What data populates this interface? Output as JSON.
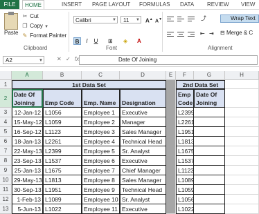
{
  "ribbon": {
    "tabs": [
      {
        "label": "FILE"
      },
      {
        "label": "HOME"
      },
      {
        "label": "INSERT"
      },
      {
        "label": "PAGE LAYOUT"
      },
      {
        "label": "FORMULAS"
      },
      {
        "label": "DATA"
      },
      {
        "label": "REVIEW"
      },
      {
        "label": "VIEW"
      }
    ],
    "clipboard": {
      "paste": "Paste",
      "cut": "Cut",
      "copy": "Copy",
      "format_painter": "Format Painter",
      "group": "Clipboard"
    },
    "font": {
      "name": "Calibri",
      "size": "11",
      "group": "Font"
    },
    "alignment": {
      "wrap": "Wrap Text",
      "merge": "Merge & C",
      "group": "Alignment"
    }
  },
  "formula_bar": {
    "name_box": "A2",
    "fx": "fx",
    "value": "Date Of Joining"
  },
  "columns": [
    "A",
    "B",
    "C",
    "D",
    "E",
    "F",
    "G",
    "H"
  ],
  "rows": [
    "1",
    "2",
    "3",
    "4",
    "5",
    "6",
    "7",
    "8",
    "9",
    "10",
    "11",
    "12",
    "13"
  ],
  "table1": {
    "title": "1st Data Set",
    "headers": [
      "Date Of Joining",
      "Emp Code",
      "Emp. Name",
      "Designation"
    ],
    "rows": [
      [
        "12-Jan-12",
        "L1056",
        "Employee 1",
        "Executive"
      ],
      [
        "15-May-12",
        "L1059",
        "Employee 2",
        "Manager"
      ],
      [
        "16-Sep-12",
        "L1123",
        "Employee 3",
        "Sales Manager"
      ],
      [
        "18-Jan-13",
        "L2261",
        "Employee 4",
        "Technical Head"
      ],
      [
        "22-May-13",
        "L2399",
        "Employee 5",
        "Sr. Analyst"
      ],
      [
        "23-Sep-13",
        "L1537",
        "Employee 6",
        "Executive"
      ],
      [
        "25-Jan-13",
        "L1675",
        "Employee 7",
        "Chief Manager"
      ],
      [
        "29-May-13",
        "L1813",
        "Employee 8",
        "Sales Manager"
      ],
      [
        "30-Sep-13",
        "L1951",
        "Employee 9",
        "Technical Head"
      ],
      [
        "1-Feb-13",
        "L1089",
        "Employee 10",
        "Sr. Analyst"
      ],
      [
        "5-Jun-13",
        "L1022",
        "Employee 11",
        "Executive"
      ]
    ]
  },
  "table2": {
    "title": "2nd Data Set",
    "headers": [
      "Emp Code",
      "Date Of Joining"
    ],
    "codes": [
      "L2399",
      "L2261",
      "L1951",
      "L1813",
      "L1675",
      "L1537",
      "L1123",
      "L1089",
      "L1059",
      "L1056",
      "L1022"
    ]
  }
}
